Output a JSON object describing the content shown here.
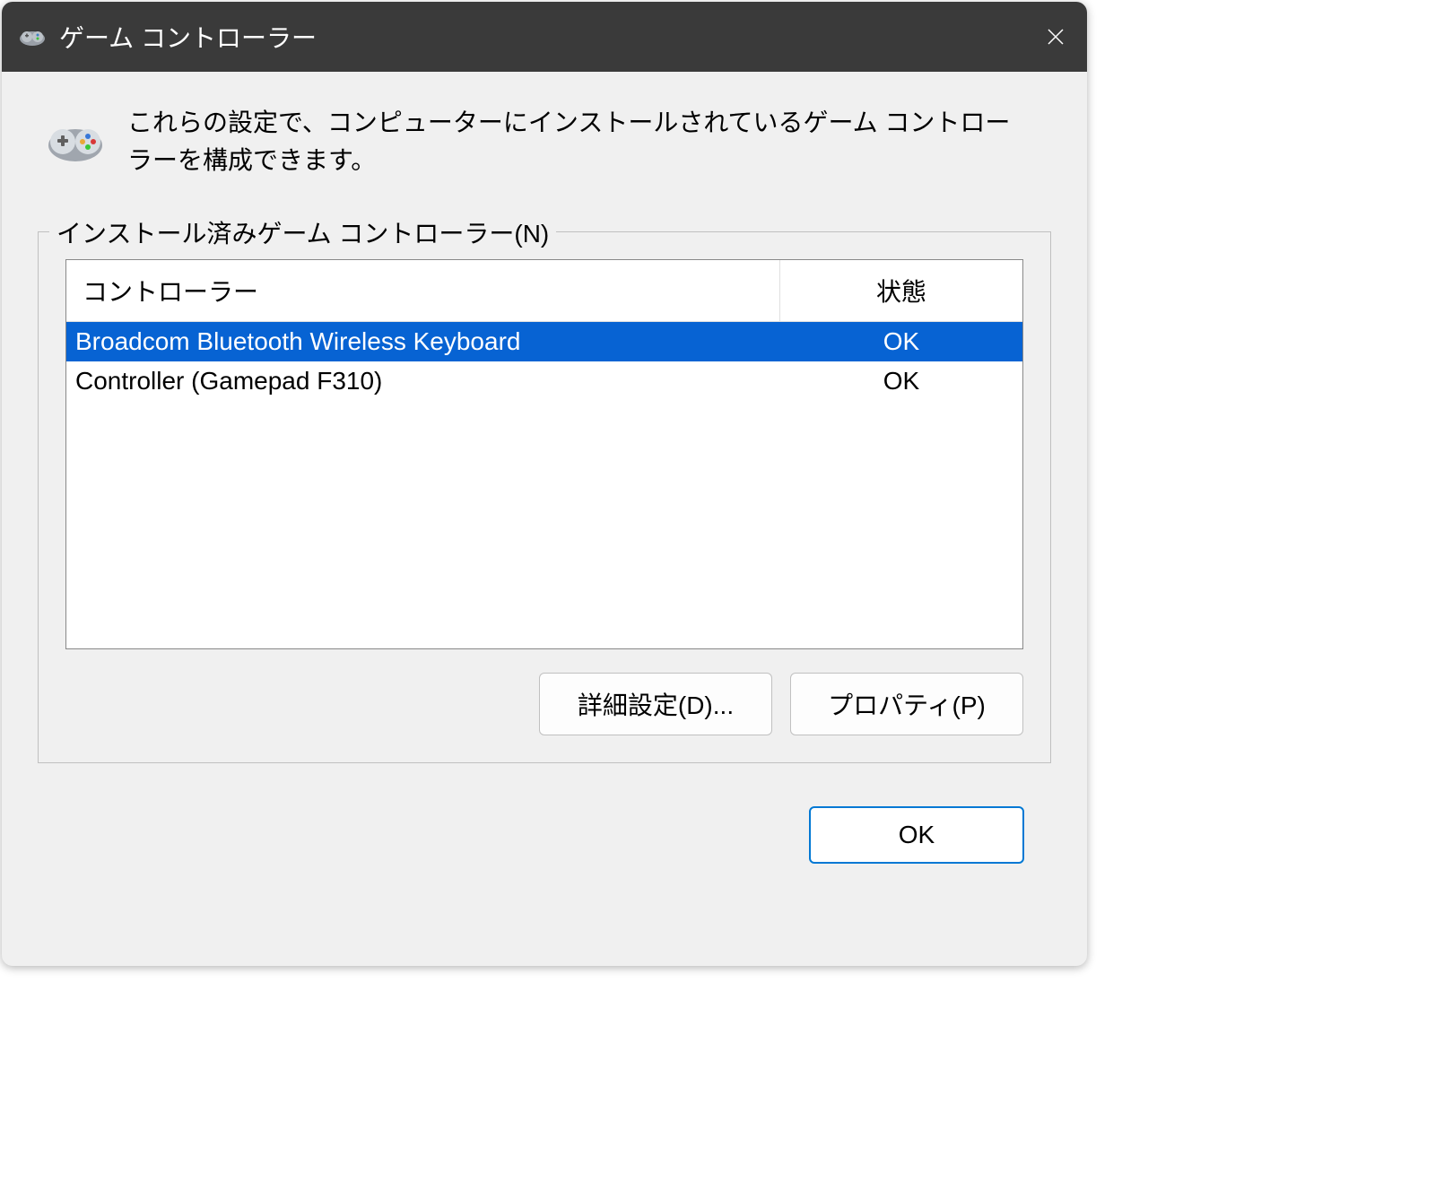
{
  "titlebar": {
    "title": "ゲーム コントローラー"
  },
  "header": {
    "description": "これらの設定で、コンピューターにインストールされているゲーム コントローラーを構成できます。"
  },
  "groupbox": {
    "label": "インストール済みゲーム コントローラー(N)",
    "columns": {
      "controller": "コントローラー",
      "status": "状態"
    },
    "rows": [
      {
        "name": "Broadcom Bluetooth Wireless  Keyboard",
        "status": "OK",
        "selected": true
      },
      {
        "name": "Controller (Gamepad F310)",
        "status": "OK",
        "selected": false
      }
    ]
  },
  "buttons": {
    "advanced": "詳細設定(D)...",
    "properties": "プロパティ(P)",
    "ok": "OK"
  }
}
